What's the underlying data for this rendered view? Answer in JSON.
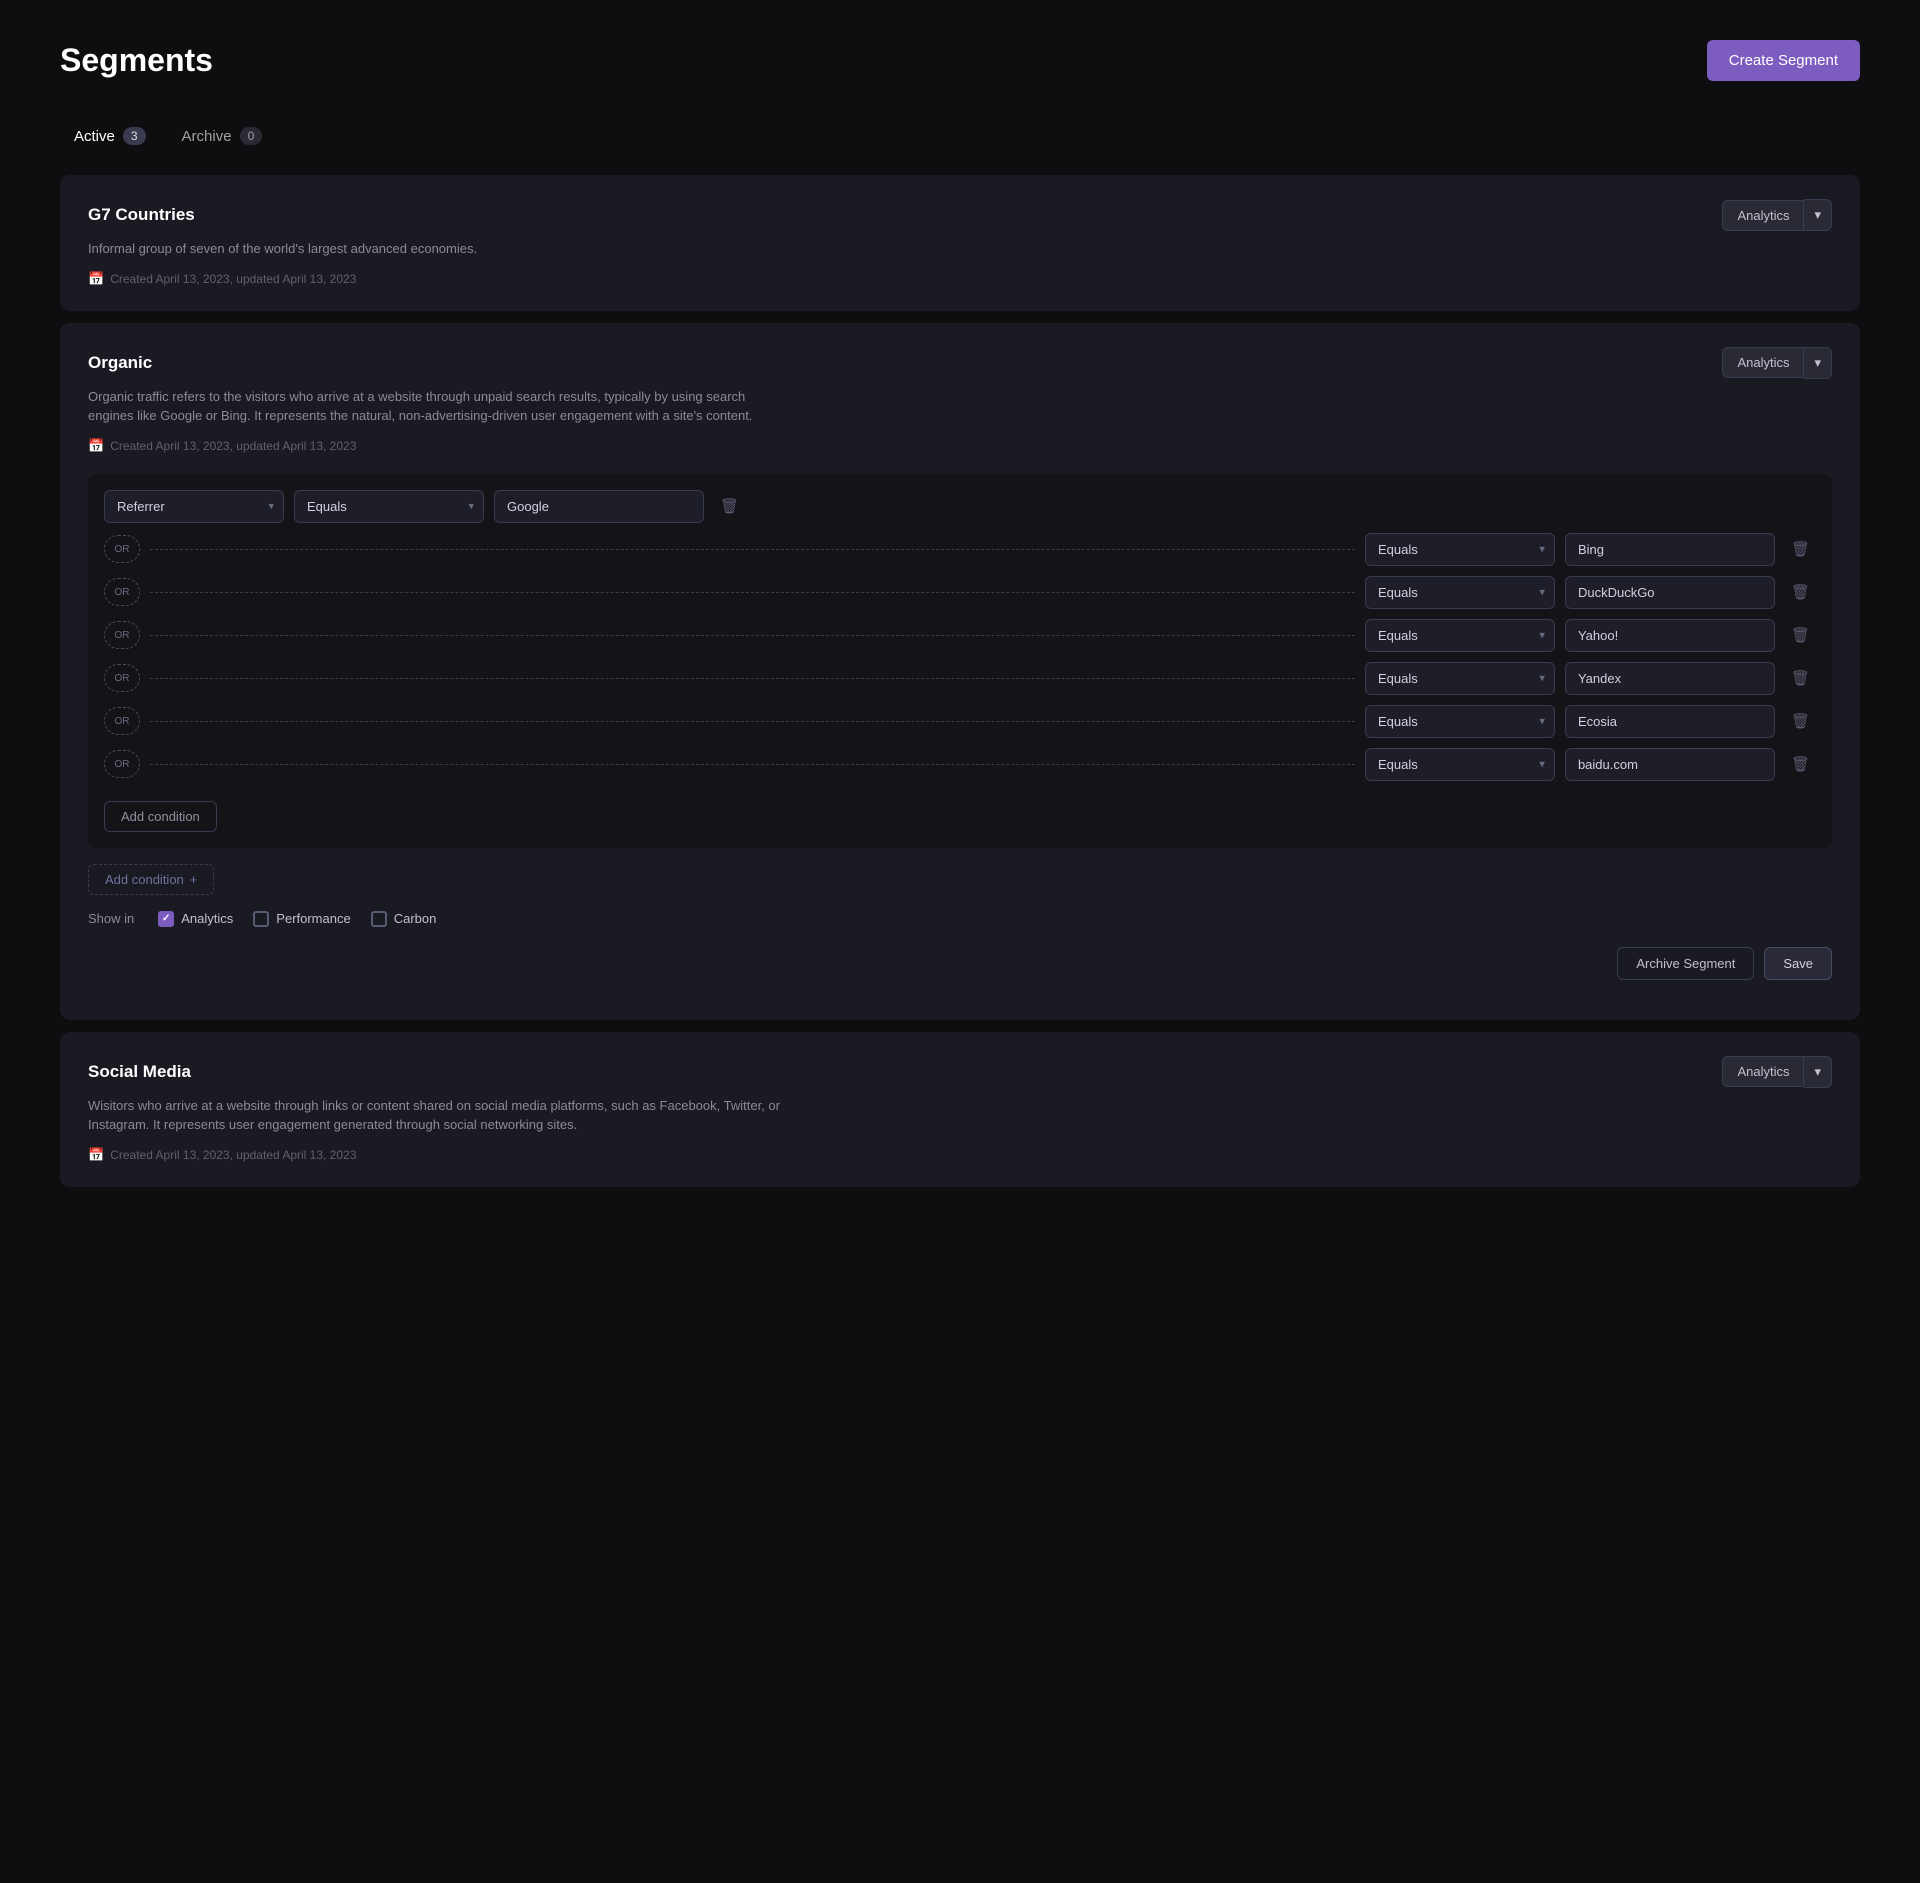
{
  "page": {
    "title": "Segments",
    "create_button": "Create Segment"
  },
  "tabs": [
    {
      "id": "active",
      "label": "Active",
      "count": "3",
      "active": true
    },
    {
      "id": "archive",
      "label": "Archive",
      "count": "0",
      "active": false
    }
  ],
  "segments": [
    {
      "id": "g7",
      "name": "G7 Countries",
      "description": "Informal group of seven of the world's largest advanced economies.",
      "meta": "Created April 13, 2023, updated April 13, 2023",
      "badge": "Analytics",
      "expanded": false
    },
    {
      "id": "organic",
      "name": "Organic",
      "description": "Organic traffic refers to the visitors who arrive at a website through unpaid search results, typically by using search engines like Google or Bing. It represents the natural, non-advertising-driven user engagement with a site's content.",
      "meta": "Created April 13, 2023, updated April 13, 2023",
      "badge": "Analytics",
      "expanded": true,
      "conditions": [
        {
          "operator": "Equals",
          "value": "Google"
        },
        {
          "operator": "Equals",
          "value": "Bing"
        },
        {
          "operator": "Equals",
          "value": "DuckDuckGo"
        },
        {
          "operator": "Equals",
          "value": "Yahoo!"
        },
        {
          "operator": "Equals",
          "value": "Yandex"
        },
        {
          "operator": "Equals",
          "value": "Ecosia"
        },
        {
          "operator": "Equals",
          "value": "baidu.com"
        }
      ],
      "field": "Referrer",
      "show_in": {
        "analytics": true,
        "performance": false,
        "carbon": false
      }
    },
    {
      "id": "social",
      "name": "Social Media",
      "description": "Wisitors who arrive at a website through links or content shared on social media platforms, such as Facebook, Twitter, or Instagram. It represents user engagement generated through social networking sites.",
      "meta": "Created April 13, 2023, updated April 13, 2023",
      "badge": "Analytics",
      "expanded": false
    }
  ],
  "labels": {
    "add_condition_inner": "Add condition",
    "add_condition_outer": "Add condition",
    "show_in": "Show in",
    "analytics": "Analytics",
    "performance": "Performance",
    "carbon": "Carbon",
    "archive_segment": "Archive Segment",
    "save": "Save",
    "or": "OR",
    "plus": "+"
  },
  "colors": {
    "accent": "#7c5cbf"
  }
}
